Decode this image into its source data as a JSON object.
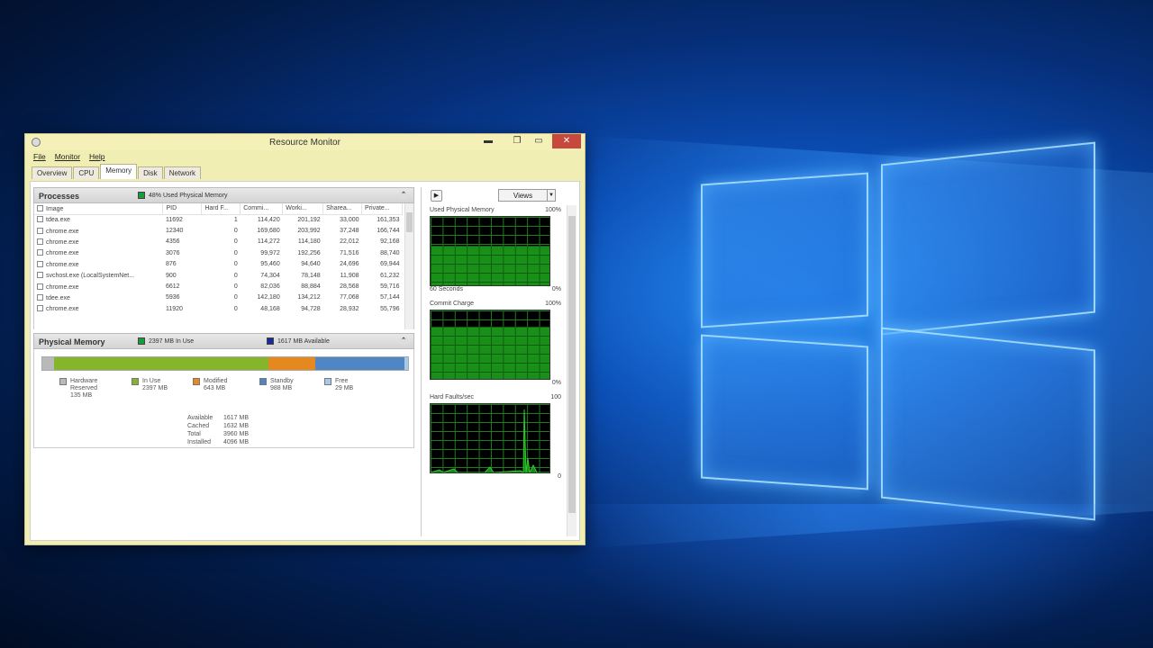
{
  "window": {
    "title": "Resource Monitor",
    "controls": {
      "minimize": "▬",
      "maximize": "❐",
      "restore": "▭",
      "close": "✕"
    }
  },
  "menu": [
    "File",
    "Monitor",
    "Help"
  ],
  "tabs": [
    "Overview",
    "CPU",
    "Memory",
    "Disk",
    "Network"
  ],
  "active_tab": "Memory",
  "processes": {
    "title": "Processes",
    "legend": "48% Used Physical Memory",
    "legend_color": "#1a9a3a",
    "columns": [
      "Image",
      "PID",
      "Hard F...",
      "Commi...",
      "Worki...",
      "Sharea...",
      "Private..."
    ],
    "rows": [
      [
        "tdea.exe",
        "11692",
        "1",
        "114,420",
        "201,192",
        "33,000",
        "161,353"
      ],
      [
        "chrome.exe",
        "12340",
        "0",
        "169,680",
        "203,992",
        "37,248",
        "166,744"
      ],
      [
        "chrome.exe",
        "4356",
        "0",
        "114,272",
        "114,180",
        "22,012",
        "92,168"
      ],
      [
        "chrome.exe",
        "3076",
        "0",
        "99,972",
        "192,256",
        "71,516",
        "88,740"
      ],
      [
        "chrome.exe",
        "876",
        "0",
        "95,460",
        "94,640",
        "24,696",
        "69,944"
      ],
      [
        "svchost.exe (LocalSystemNet...",
        "900",
        "0",
        "74,304",
        "78,148",
        "11,908",
        "61,232"
      ],
      [
        "chrome.exe",
        "6612",
        "0",
        "82,036",
        "88,884",
        "28,568",
        "59,716"
      ],
      [
        "tdee.exe",
        "5936",
        "0",
        "142,180",
        "134,212",
        "77,068",
        "57,144"
      ],
      [
        "chrome.exe",
        "11920",
        "0",
        "48,168",
        "94,728",
        "28,932",
        "55,796"
      ]
    ]
  },
  "physical_memory": {
    "title": "Physical Memory",
    "legend_inuse": "2397 MB In Use",
    "legend_avail": "1617 MB Available",
    "inuse_color": "#1a9a3a",
    "avail_color": "#1a2a9a",
    "segments": [
      {
        "label1": "Hardware",
        "label2": "Reserved",
        "value": "135 MB",
        "color": "#b9b9b9",
        "fraction": 0.033
      },
      {
        "label1": "In Use",
        "label2": "",
        "value": "2397 MB",
        "color": "#85b52a",
        "fraction": 0.585
      },
      {
        "label1": "Modified",
        "label2": "",
        "value": "643 MB",
        "color": "#e5891e",
        "fraction": 0.128
      },
      {
        "label1": "Standby",
        "label2": "",
        "value": "988 MB",
        "color": "#4f86c6",
        "fraction": 0.244
      },
      {
        "label1": "Free",
        "label2": "",
        "value": "29 MB",
        "color": "#a8c8ea",
        "fraction": 0.01
      }
    ],
    "stats": [
      {
        "label": "Available",
        "value": "1617 MB"
      },
      {
        "label": "Cached",
        "value": "1632 MB"
      },
      {
        "label": "Total",
        "value": "3960 MB"
      },
      {
        "label": "Installed",
        "value": "4096 MB"
      }
    ]
  },
  "right_panel": {
    "expand_icon": "▶",
    "views_label": "Views",
    "views_dropdown": "▼",
    "graphs": [
      {
        "title": "Used Physical Memory",
        "top_value": "100%",
        "foot_left": "60 Seconds",
        "foot_right": "0%",
        "fill": 0.58
      },
      {
        "title": "Commit Charge",
        "top_value": "100%",
        "foot_left": "",
        "foot_right": "0%",
        "fill": 0.76
      },
      {
        "title": "Hard Faults/sec",
        "top_value": "100",
        "foot_left": "",
        "foot_right": "0",
        "fill": 0.0
      }
    ]
  },
  "wallpaper": {
    "accent": "#1e7fe6"
  }
}
